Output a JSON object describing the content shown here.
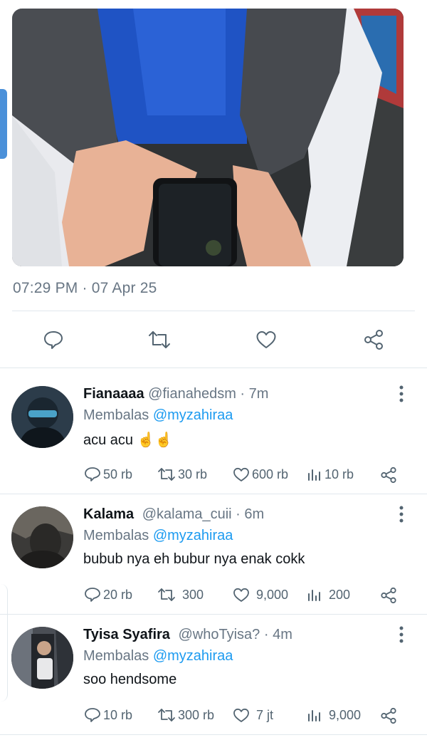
{
  "tweet": {
    "timestamp": "07:29 PM · 07 Apr 25"
  },
  "actions": {
    "icons": [
      "reply-icon",
      "retweet-icon",
      "like-icon",
      "share-icon"
    ]
  },
  "replies": [
    {
      "name": "Fianaaaa",
      "handle": "@fianahedsm · 7m",
      "replying_prefix": "Membalas ",
      "replying_mention": "@myzahiraa",
      "text": "acu acu ☝️☝️",
      "replies": "50 rb",
      "retweets": "30 rb",
      "likes": "600 rb",
      "views": "10 rb"
    },
    {
      "name": "Kalama",
      "handle": "@kalama_cuii · 6m",
      "replying_prefix": "Membalas ",
      "replying_mention": "@myzahiraa",
      "text": "bubub nya eh bubur nya enak cokk",
      "replies": "20 rb",
      "retweets": "300",
      "likes": "9,000",
      "views": "200"
    },
    {
      "name": "Tyisa Syafira",
      "handle": "@whoTyisa? · 4m",
      "replying_prefix": "Membalas ",
      "replying_mention": "@myzahiraa",
      "text": "soo hendsome",
      "replies": "10 rb",
      "retweets": "300 rb",
      "likes": "7 jt",
      "views": "9,000"
    }
  ],
  "colors": {
    "accent": "#1d9bf0",
    "muted": "#687684",
    "divider": "#e1e8ed"
  }
}
